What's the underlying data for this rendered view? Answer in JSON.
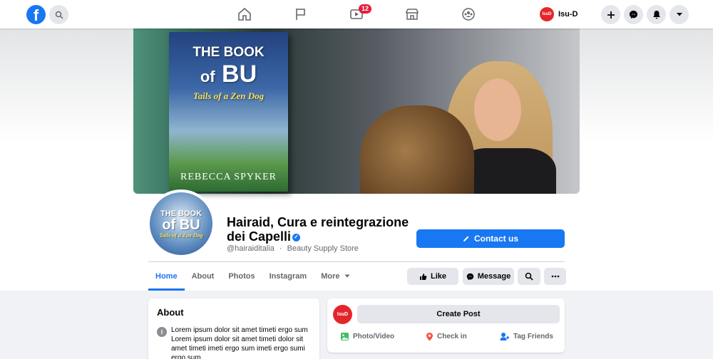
{
  "topbar": {
    "logo_letter": "f",
    "notification_badge": "12",
    "user_avatar_text": "IsuD",
    "user_name": "Isu-D"
  },
  "cover": {
    "book_line1": "THE BOOK",
    "book_of": "of",
    "book_bu": "BU",
    "book_subtitle": "Tails of a Zen Dog",
    "book_author": "REBECCA SPYKER"
  },
  "profile": {
    "pic_line1": "THE BOOK",
    "pic_line2": "of BU",
    "pic_line3": "Tails of a Zen Dog",
    "page_name": "Hairaid, Cura e reintegrazione dei Capelli",
    "handle": "@hairaiditalia",
    "separator": "·",
    "category": "Beauty Supply Store",
    "contact_label": "Contact us"
  },
  "tabs": [
    "Home",
    "About",
    "Photos",
    "Instagram",
    "More"
  ],
  "actions": {
    "like": "Like",
    "message": "Message"
  },
  "about": {
    "title": "About",
    "text": "Lorem ipsum dolor sit amet timeti ergo sum Lorem ipsum dolor sit amet timeti dolor sit amet timeti imeti ergo sum imeti ergo sumi ergo sum."
  },
  "composer": {
    "avatar_text": "IsuD",
    "create_post": "Create Post",
    "photo_video": "Photo/Video",
    "check_in": "Check in",
    "tag_friends": "Tag Friends"
  },
  "colors": {
    "accent": "#1877f2",
    "badge": "#e41e3f",
    "avatar_red": "#e4262b"
  }
}
